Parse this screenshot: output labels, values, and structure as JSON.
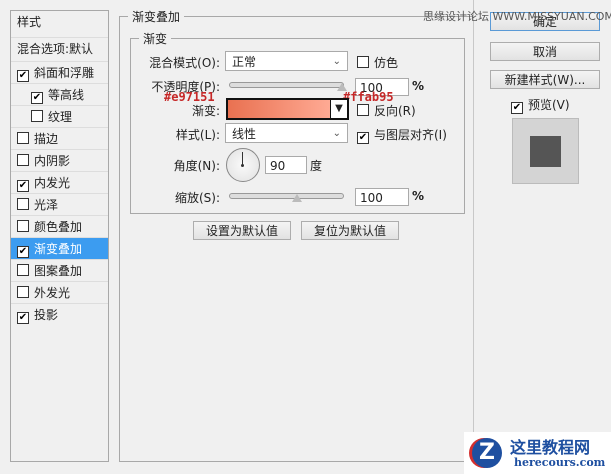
{
  "sidebar": {
    "header": "样式",
    "blend_options": "混合选项:默认",
    "items": [
      {
        "label": "斜面和浮雕",
        "checked": true
      },
      {
        "label": "等高线",
        "checked": true,
        "indent": true
      },
      {
        "label": "纹理",
        "checked": false,
        "indent": true
      },
      {
        "label": "描边",
        "checked": false
      },
      {
        "label": "内阴影",
        "checked": false
      },
      {
        "label": "内发光",
        "checked": true
      },
      {
        "label": "光泽",
        "checked": false
      },
      {
        "label": "颜色叠加",
        "checked": false
      },
      {
        "label": "渐变叠加",
        "checked": true,
        "selected": true
      },
      {
        "label": "图案叠加",
        "checked": false
      },
      {
        "label": "外发光",
        "checked": false
      },
      {
        "label": "投影",
        "checked": true
      }
    ]
  },
  "panel": {
    "title": "渐变叠加",
    "group": "渐变",
    "blend_mode_label": "混合模式(O):",
    "blend_mode": "正常",
    "dither_label": "仿色",
    "opacity_label": "不透明度(P):",
    "opacity": "100",
    "percent": "%",
    "gradient_label": "渐变:",
    "reverse_label": "反向(R)",
    "style_label": "样式(L):",
    "style": "线性",
    "align_label": "与图层对齐(I)",
    "angle_label": "角度(N):",
    "angle": "90",
    "degree": "度",
    "scale_label": "缩放(S):",
    "scale": "100",
    "make_default": "设置为默认值",
    "reset_default": "复位为默认值"
  },
  "annotations": {
    "start_color": "#e97151",
    "end_color": "#ffab95",
    "watermark": "思缘设计论坛 WWW.MISSYUAN.COM"
  },
  "buttons": {
    "ok": "确定",
    "cancel": "取消",
    "new_style": "新建样式(W)...",
    "preview": "预览(V)"
  },
  "logo": {
    "title": "这里教程网",
    "url": "herecours.com"
  }
}
